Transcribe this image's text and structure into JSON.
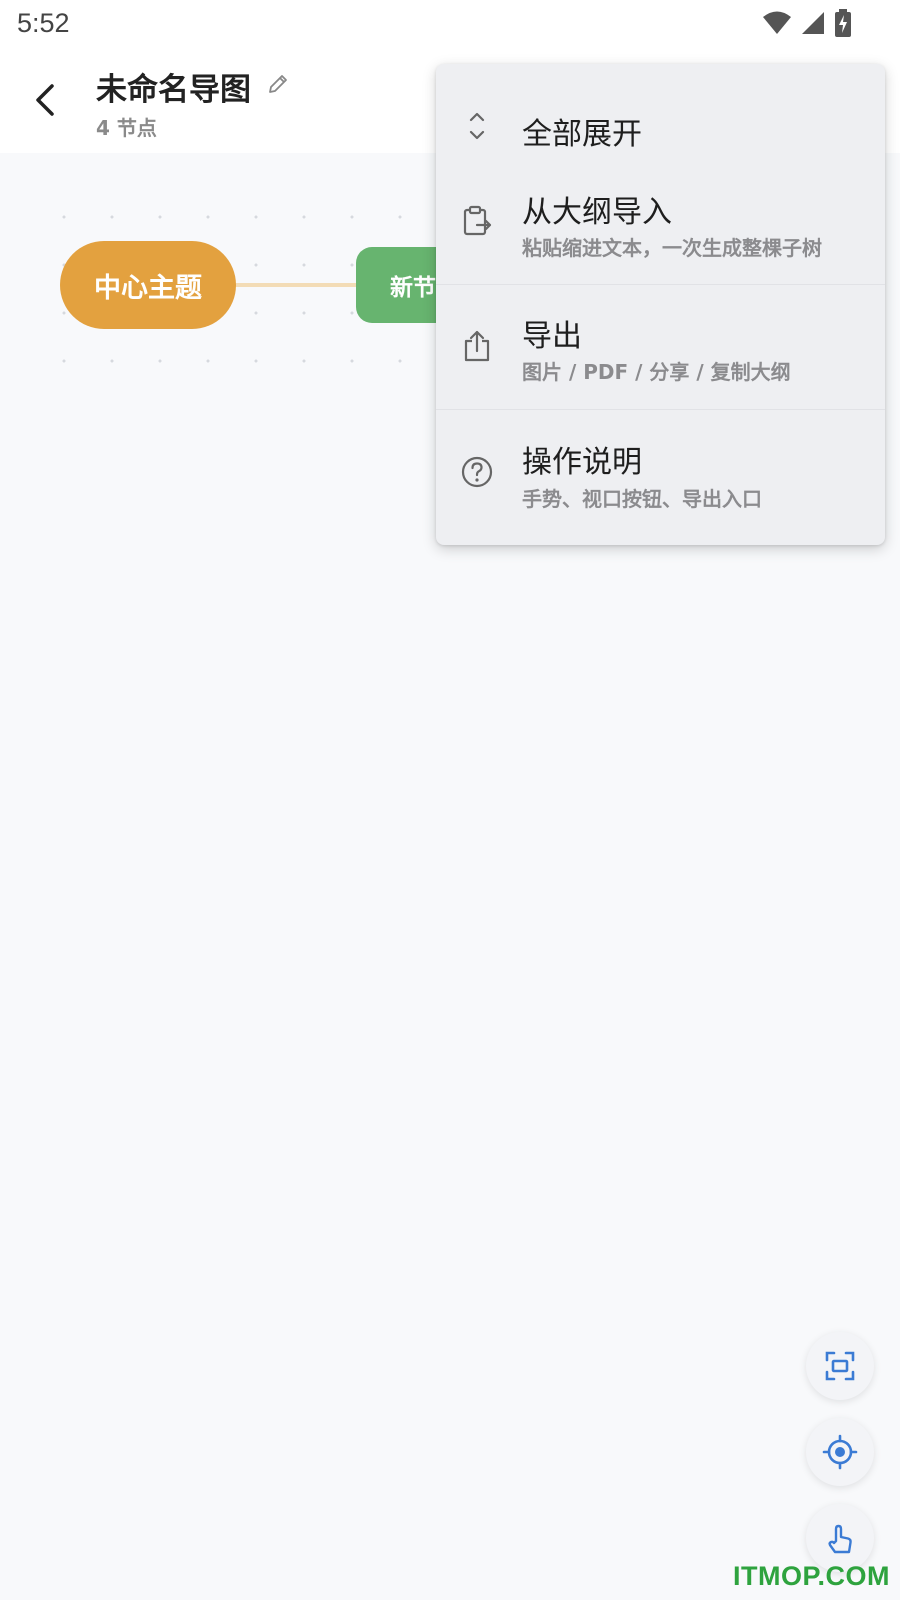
{
  "status_bar": {
    "time": "5:52"
  },
  "header": {
    "title": "未命名导图",
    "node_count": "4 节点"
  },
  "canvas": {
    "center_node": "中心主题",
    "child_node": "新节"
  },
  "menu": {
    "items": [
      {
        "label": "全部展开",
        "description": "",
        "icon": "expand-all-icon"
      },
      {
        "label": "从大纲导入",
        "description": "粘贴缩进文本，一次生成整棵子树",
        "icon": "clipboard-import-icon"
      },
      {
        "label": "导出",
        "description": "图片 / PDF / 分享 / 复制大纲",
        "icon": "share-icon"
      },
      {
        "label": "操作说明",
        "description": "手势、视口按钮、导出入口",
        "icon": "help-icon"
      }
    ]
  },
  "fabs": [
    "fit-view-icon",
    "locate-center-icon",
    "touch-mode-icon"
  ],
  "watermark": "ITMOP.COM",
  "colors": {
    "center_node": "#e3a13f",
    "child_node": "#67b46f",
    "accent_blue": "#3b7bd4"
  }
}
